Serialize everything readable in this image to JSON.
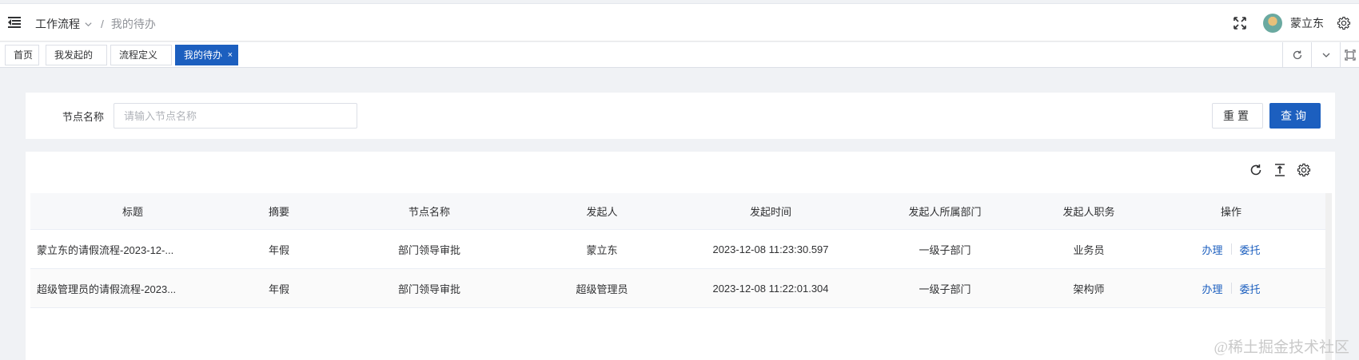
{
  "header": {
    "breadcrumb": {
      "parent": "工作流程",
      "current": "我的待办",
      "separator": "/"
    },
    "user": {
      "name": "蒙立东"
    },
    "icons": [
      "menu-fold-icon",
      "chevron-down-icon",
      "fullscreen-icon",
      "avatar",
      "gear-icon"
    ]
  },
  "tabs": [
    {
      "label": "首页",
      "active": false
    },
    {
      "label": "我发起的",
      "active": false
    },
    {
      "label": "流程定义",
      "active": false
    },
    {
      "label": "我的待办",
      "active": true,
      "close": "×"
    }
  ],
  "search": {
    "node_label": "节点名称",
    "node_placeholder": "请输入节点名称",
    "node_value": "",
    "reset_label": "重置",
    "query_label": "查询"
  },
  "table": {
    "columns": [
      "标题",
      "摘要",
      "节点名称",
      "发起人",
      "发起时间",
      "发起人所属部门",
      "发起人职务",
      "操作"
    ],
    "rows": [
      {
        "title": "蒙立东的请假流程-2023-12-...",
        "summary": "年假",
        "node": "部门领导审批",
        "initiator": "蒙立东",
        "time": "2023-12-08 11:23:30.597",
        "dept": "一级子部门",
        "position": "业务员",
        "action_handle": "办理",
        "action_delegate": "委托"
      },
      {
        "title": "超级管理员的请假流程-2023...",
        "summary": "年假",
        "node": "部门领导审批",
        "initiator": "超级管理员",
        "time": "2023-12-08 11:22:01.304",
        "dept": "一级子部门",
        "position": "架构师",
        "action_handle": "办理",
        "action_delegate": "委托"
      }
    ]
  },
  "watermark": "@稀土掘金技术社区",
  "colors": {
    "primary": "#1c5fbf",
    "background": "#f0f2f5"
  }
}
